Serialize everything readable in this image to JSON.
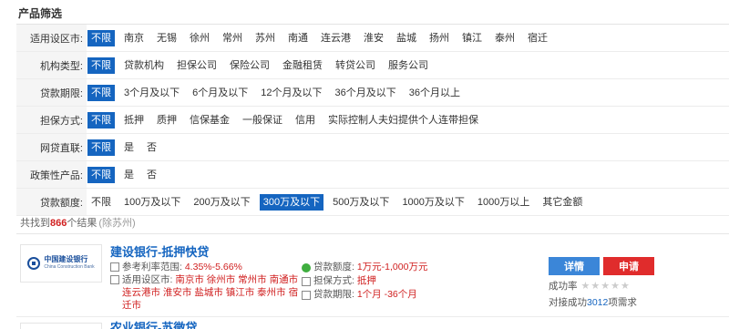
{
  "section_title": "产品筛选",
  "filters": [
    {
      "label": "适用设区市:",
      "options": [
        "不限",
        "南京",
        "无锡",
        "徐州",
        "常州",
        "苏州",
        "南通",
        "连云港",
        "淮安",
        "盐城",
        "扬州",
        "镇江",
        "泰州",
        "宿迁"
      ],
      "active": 0
    },
    {
      "label": "机构类型:",
      "options": [
        "不限",
        "贷款机构",
        "担保公司",
        "保险公司",
        "金融租赁",
        "转贷公司",
        "服务公司"
      ],
      "active": 0
    },
    {
      "label": "贷款期限:",
      "options": [
        "不限",
        "3个月及以下",
        "6个月及以下",
        "12个月及以下",
        "36个月及以下",
        "36个月以上"
      ],
      "active": 0
    },
    {
      "label": "担保方式:",
      "options": [
        "不限",
        "抵押",
        "质押",
        "信保基金",
        "一般保证",
        "信用",
        "实际控制人夫妇提供个人连带担保"
      ],
      "active": 0
    },
    {
      "label": "网贷直联:",
      "options": [
        "不限",
        "是",
        "否"
      ],
      "active": 0
    },
    {
      "label": "政策性产品:",
      "options": [
        "不限",
        "是",
        "否"
      ],
      "active": 0
    },
    {
      "label": "贷款额度:",
      "options": [
        "不限",
        "100万及以下",
        "200万及以下",
        "300万及以下",
        "500万及以下",
        "1000万及以下",
        "1000万以上",
        "其它金额"
      ],
      "active": 3
    }
  ],
  "result": {
    "prefix": "共找到",
    "count": "866",
    "suffix": "个结果",
    "exclude": "(除苏州)"
  },
  "card": {
    "logo_cn": "中国建设银行",
    "logo_en": "China Construction Bank",
    "title": "建设银行-抵押快贷",
    "rate_label": "参考利率范围:",
    "rate_value": "4.35%-5.66%",
    "city_label": "适用设区市:",
    "city_value": "南京市 徐州市 常州市 南通市 连云港市 淮安市 盐城市 镇江市 泰州市 宿迁市",
    "amount_label": "贷款额度:",
    "amount_value": "1万元-1,000万元",
    "guarantee_label": "担保方式:",
    "guarantee_value": "抵押",
    "term_label": "贷款期限:",
    "term_value": "1个月 -36个月",
    "detail_btn": "详情",
    "apply_btn": "申请",
    "success_label": "成功率",
    "stars": "★★★★★",
    "served_prefix": "对接成功",
    "served_count": "3012",
    "served_suffix": "项需求"
  },
  "next_card": {
    "title": "农业银行-苏微贷"
  },
  "colors": {
    "active_option": "#1565c0",
    "detail_button": "#3b86d8",
    "apply_button": "#e02c2c",
    "highlight_red": "#d01f1f",
    "title_blue": "#1565c0"
  }
}
